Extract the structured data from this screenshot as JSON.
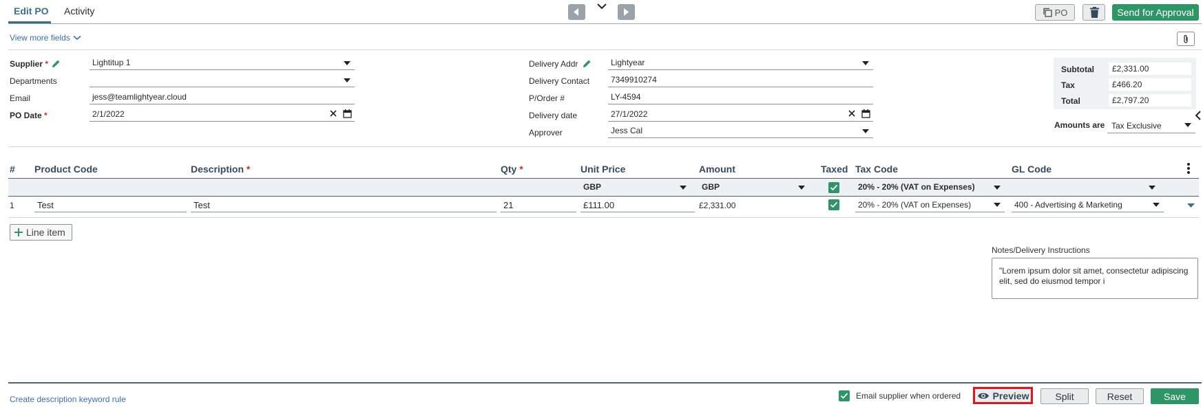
{
  "tabs": [
    {
      "label": "Edit PO",
      "active": true
    },
    {
      "label": "Activity",
      "active": false
    }
  ],
  "toolbar": {
    "po_label": "PO",
    "send_for_approval_label": "Send for Approval"
  },
  "view_more_fields_label": "View more fields",
  "form": {
    "supplier": {
      "label": "Supplier",
      "value": "Lightitup 1"
    },
    "departments": {
      "label": "Departments",
      "value": ""
    },
    "email": {
      "label": "Email",
      "value": "jess@teamlightyear.cloud"
    },
    "po_date": {
      "label": "PO Date",
      "value": "2/1/2022"
    },
    "delivery_addr": {
      "label": "Delivery Addr",
      "value": "Lightyear"
    },
    "delivery_contact": {
      "label": "Delivery Contact",
      "value": "7349910274"
    },
    "p_order": {
      "label": "P/Order #",
      "value": "LY-4594"
    },
    "delivery_date": {
      "label": "Delivery date",
      "value": "27/1/2022"
    },
    "approver": {
      "label": "Approver",
      "value": "Jess Cal"
    }
  },
  "totals": {
    "subtotal_label": "Subtotal",
    "subtotal": "£2,331.00",
    "tax_label": "Tax",
    "tax": "£466.20",
    "total_label": "Total",
    "total": "£2,797.20",
    "amounts_are_label": "Amounts are",
    "amounts_are_value": "Tax Exclusive"
  },
  "table": {
    "headers": {
      "num": "#",
      "product_code": "Product Code",
      "description": "Description",
      "qty": "Qty",
      "unit_price": "Unit Price",
      "amount": "Amount",
      "taxed": "Taxed",
      "tax_code": "Tax Code",
      "gl_code": "GL Code"
    },
    "defaults": {
      "unit_price_currency": "GBP",
      "amount_currency": "GBP",
      "taxed": true,
      "tax_code": "20% - 20% (VAT on Expenses)",
      "gl_code": ""
    },
    "rows": [
      {
        "num": "1",
        "product_code": "Test",
        "description": "Test",
        "qty": "21",
        "unit_price": "£111.00",
        "amount": "£2,331.00",
        "taxed": true,
        "tax_code": "20% - 20% (VAT on Expenses)",
        "gl_code": "400 - Advertising & Marketing"
      }
    ]
  },
  "line_item_label": "Line item",
  "notes": {
    "label": "Notes/Delivery Instructions",
    "value": "\"Lorem ipsum dolor sit amet, consectetur adipiscing elit, sed do eiusmod tempor i"
  },
  "footer": {
    "keyword_rule_link": "Create description keyword rule",
    "email_supplier_label": "Email supplier when ordered",
    "email_supplier_checked": true,
    "preview_label": "Preview",
    "split_label": "Split",
    "reset_label": "Reset",
    "save_label": "Save"
  },
  "colors": {
    "accent": "#3d6e84",
    "primary_green": "#2d9566",
    "required_red": "#c0392b",
    "highlight_red": "#e0161b",
    "link_blue": "#3a6fb0"
  }
}
